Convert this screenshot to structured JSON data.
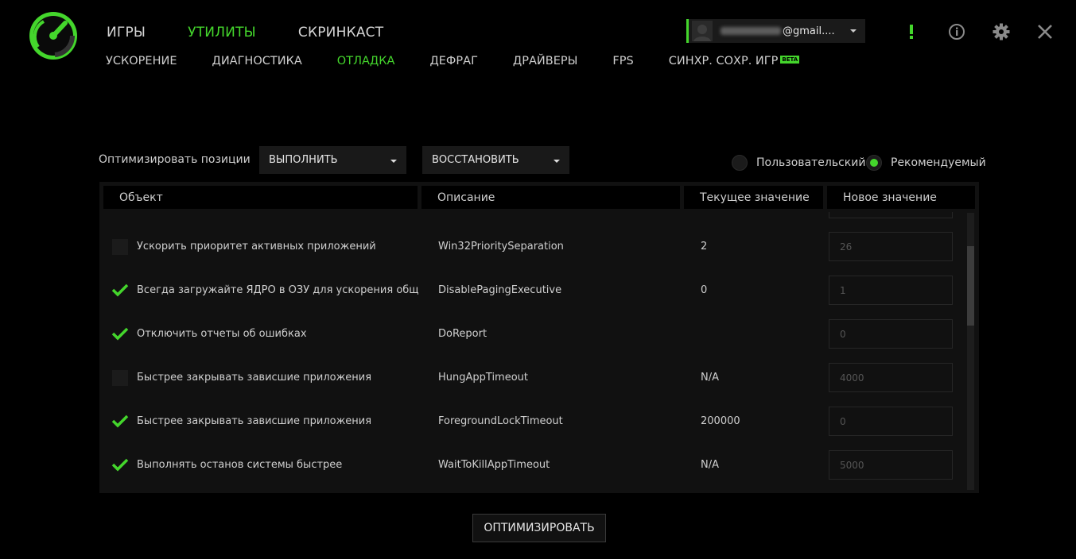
{
  "colors": {
    "accent": "#44d62c",
    "background": "#000000",
    "panel": "#111111"
  },
  "main_nav": [
    {
      "label": "ИГРЫ",
      "active": false
    },
    {
      "label": "УТИЛИТЫ",
      "active": true
    },
    {
      "label": "СКРИНКАСТ",
      "active": false
    }
  ],
  "sub_nav": [
    {
      "label": "УСКОРЕНИЕ"
    },
    {
      "label": "ДИАГНОСТИКА"
    },
    {
      "label": "ОТЛАДКА",
      "active": true
    },
    {
      "label": "ДЕФРАГ"
    },
    {
      "label": "ДРАЙВЕРЫ"
    },
    {
      "label": "FPS"
    },
    {
      "label": "СИНХР. СОХР. ИГР",
      "badge": "BETA"
    }
  ],
  "account": {
    "email_suffix": "@gmail...."
  },
  "toolbar": {
    "optimize_label": "Оптимизировать позиции",
    "execute": "ВЫПОЛНИТЬ",
    "restore": "ВОССТАНОВИТЬ",
    "radio_custom": "Пользовательский",
    "radio_recommended": "Рекомендуемый",
    "selected_mode": "recommended"
  },
  "table": {
    "headers": [
      "Объект",
      "Описание",
      "Текущее значение",
      "Новое значение"
    ],
    "rows": [
      {
        "checked": false,
        "object": "Ускорить приоритет активных приложений",
        "description": "Win32PrioritySeparation",
        "current": "2",
        "new": "26"
      },
      {
        "checked": true,
        "object": "Всегда загружайте ЯДРО в ОЗУ для ускорения общей производительности",
        "description": "DisablePagingExecutive",
        "current": "0",
        "new": "1"
      },
      {
        "checked": true,
        "object": "Отключить отчеты об ошибках",
        "description": "DoReport",
        "current": "",
        "new": "0"
      },
      {
        "checked": false,
        "object": "Быстрее закрывать зависшие приложения",
        "description": "HungAppTimeout",
        "current": "N/A",
        "new": "4000"
      },
      {
        "checked": true,
        "object": "Быстрее закрывать зависшие приложения",
        "description": "ForegroundLockTimeout",
        "current": "200000",
        "new": "0"
      },
      {
        "checked": true,
        "object": "Выполнять останов системы быстрее",
        "description": "WaitToKillAppTimeout",
        "current": "N/A",
        "new": "5000"
      }
    ]
  },
  "optimize_button": "ОПТИМИЗИРОВАТЬ",
  "icons": [
    "app-logo-icon",
    "user-avatar-icon",
    "alert-icon",
    "info-icon",
    "gear-icon",
    "close-icon",
    "check-icon"
  ]
}
